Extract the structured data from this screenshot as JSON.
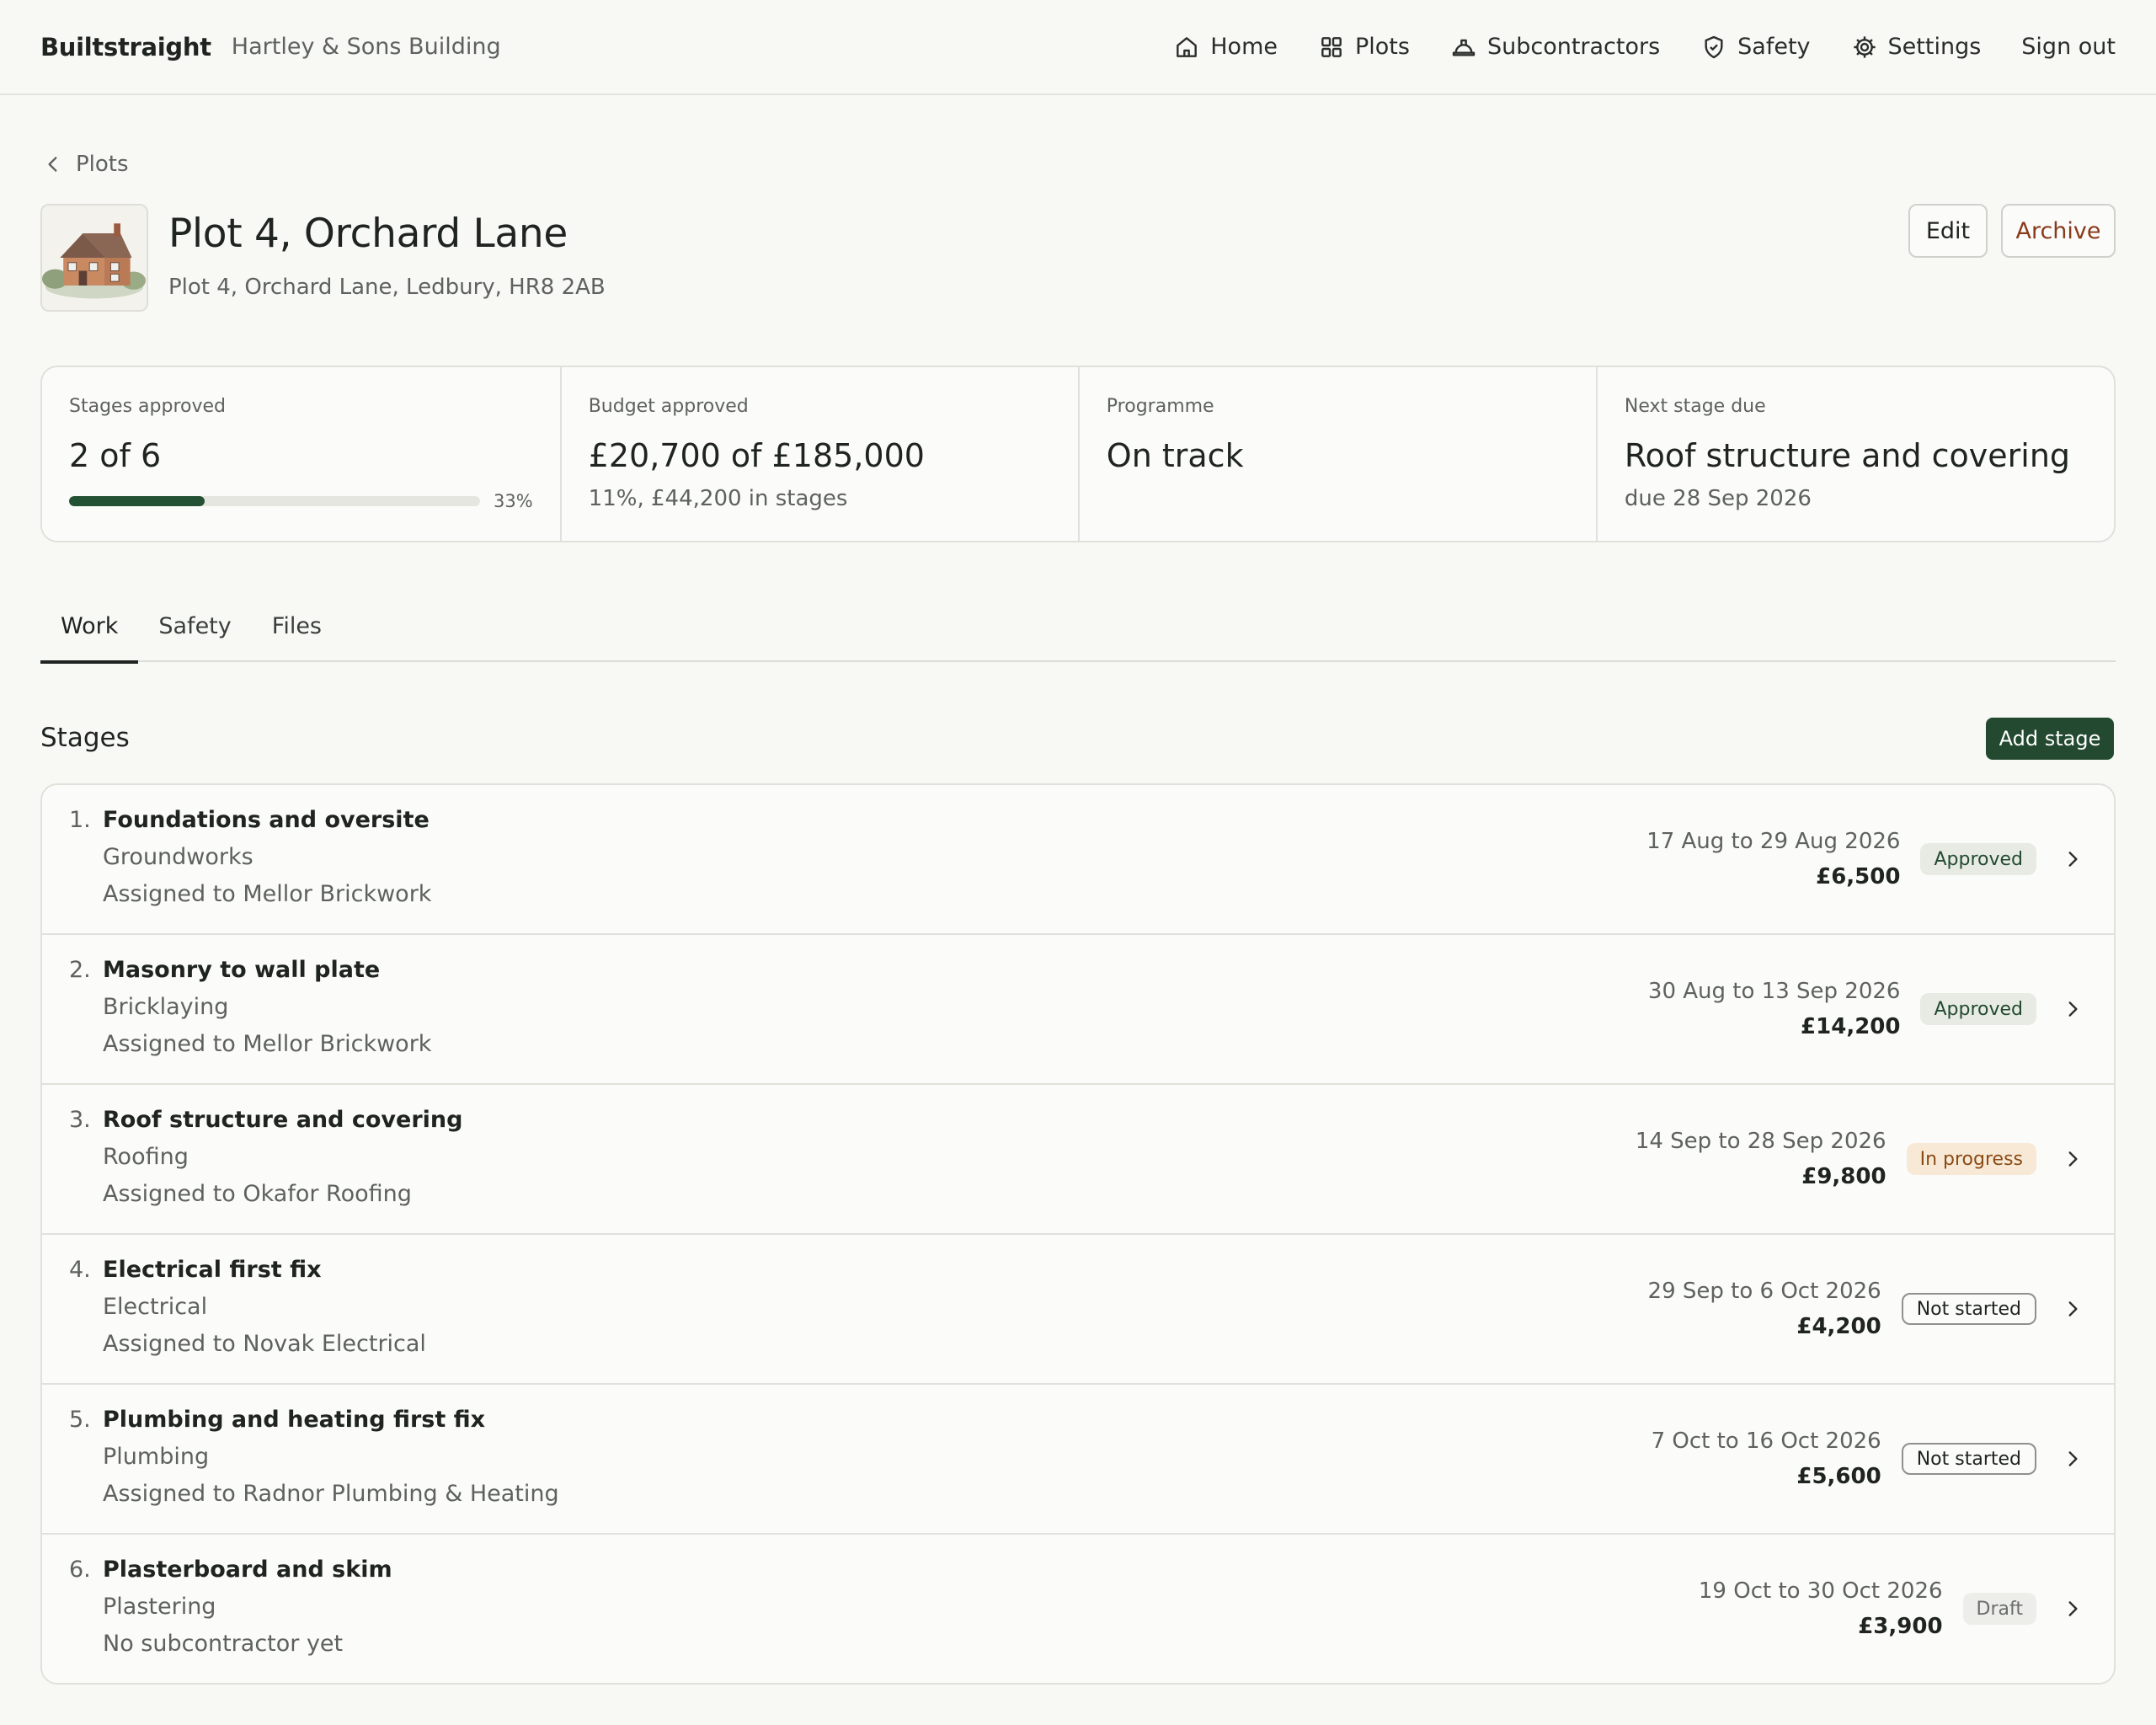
{
  "topbar": {
    "brand": "Builtstraight",
    "org": "Hartley & Sons Building",
    "nav": [
      {
        "label": "Home",
        "icon": "home-icon"
      },
      {
        "label": "Plots",
        "icon": "grid-icon"
      },
      {
        "label": "Subcontractors",
        "icon": "hard-hat-icon"
      },
      {
        "label": "Safety",
        "icon": "shield-check-icon"
      },
      {
        "label": "Settings",
        "icon": "gear-icon"
      },
      {
        "label": "Sign out",
        "icon": ""
      }
    ]
  },
  "breadcrumb": {
    "back_label": "Plots"
  },
  "plot": {
    "title": "Plot 4, Orchard Lane",
    "address": "Plot 4, Orchard Lane, Ledbury, HR8 2AB",
    "edit_label": "Edit",
    "archive_label": "Archive"
  },
  "summary": {
    "stages": {
      "label": "Stages approved",
      "value": "2 of 6",
      "progress": 0.33,
      "percent_label": "33%"
    },
    "budget": {
      "label": "Budget approved",
      "value": "£20,700 of £185,000",
      "sub": "11%, £44,200 in stages"
    },
    "programme": {
      "label": "Programme",
      "value": "On track"
    },
    "next": {
      "label": "Next stage due",
      "value": "Roof structure and covering",
      "sub": "due 28 Sep 2026"
    }
  },
  "tabs": [
    {
      "label": "Work",
      "active": true
    },
    {
      "label": "Safety",
      "active": false
    },
    {
      "label": "Files",
      "active": false
    }
  ],
  "stages_section": {
    "title": "Stages",
    "add_label": "Add stage",
    "items": [
      {
        "num": "1.",
        "name": "Foundations and oversite",
        "trade": "Groundworks",
        "assigned": "Assigned to Mellor Brickwork",
        "dates": "17 Aug to 29 Aug 2026",
        "amount": "£6,500",
        "status": "Approved",
        "status_kind": "approved"
      },
      {
        "num": "2.",
        "name": "Masonry to wall plate",
        "trade": "Bricklaying",
        "assigned": "Assigned to Mellor Brickwork",
        "dates": "30 Aug to 13 Sep 2026",
        "amount": "£14,200",
        "status": "Approved",
        "status_kind": "approved"
      },
      {
        "num": "3.",
        "name": "Roof structure and covering",
        "trade": "Roofing",
        "assigned": "Assigned to Okafor Roofing",
        "dates": "14 Sep to 28 Sep 2026",
        "amount": "£9,800",
        "status": "In progress",
        "status_kind": "inprogress"
      },
      {
        "num": "4.",
        "name": "Electrical first fix",
        "trade": "Electrical",
        "assigned": "Assigned to Novak Electrical",
        "dates": "29 Sep to 6 Oct 2026",
        "amount": "£4,200",
        "status": "Not started",
        "status_kind": "notstarted"
      },
      {
        "num": "5.",
        "name": "Plumbing and heating first fix",
        "trade": "Plumbing",
        "assigned": "Assigned to Radnor Plumbing & Heating",
        "dates": "7 Oct to 16 Oct 2026",
        "amount": "£5,600",
        "status": "Not started",
        "status_kind": "notstarted"
      },
      {
        "num": "6.",
        "name": "Plasterboard and skim",
        "trade": "Plastering",
        "assigned": "No subcontractor yet",
        "dates": "19 Oct to 30 Oct 2026",
        "amount": "£3,900",
        "status": "Draft",
        "status_kind": "draft"
      }
    ]
  },
  "colors": {
    "background": "#f8f8f5",
    "primary": "#234a30",
    "archive_text": "#8a3a1a",
    "approved_bg": "#e7ebe4",
    "inprogress_bg": "#f8e9d7"
  }
}
